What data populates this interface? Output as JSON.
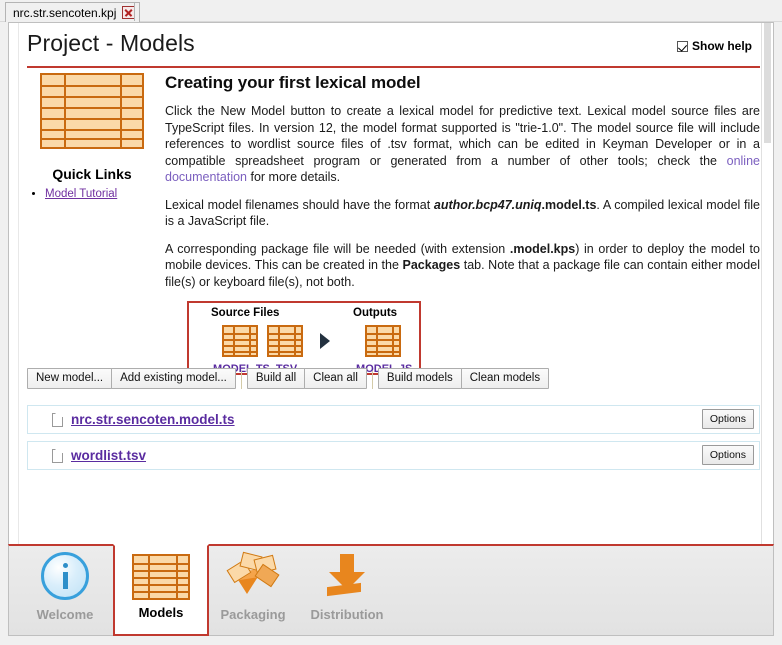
{
  "window": {
    "document_tab": {
      "label": "nrc.str.sencoten.kpj",
      "close_icon": "close-icon"
    }
  },
  "header": {
    "title": "Project - Models",
    "show_help_label": "Show help",
    "show_help_checked": true,
    "accent_color": "#c0392f"
  },
  "quick_links": {
    "icon": "model-grid-icon",
    "title": "Quick Links",
    "links": [
      {
        "label": "Model Tutorial"
      }
    ]
  },
  "help": {
    "section_title": "Creating your first lexical model",
    "paragraph1": {
      "before_link": "Click the New Model button to create a lexical model for predictive text. Lexical model source files are TypeScript files. In version 12, the model format supported is \"trie-1.0\". The model source file will include references to wordlist source files of .tsv format, which can be edited in Keyman Developer or in a compatible spreadsheet program or generated from a number of other tools; check the ",
      "link_text": "online documentation",
      "after_link": " for more details."
    },
    "paragraph2": {
      "part1": "Lexical model filenames should have the format ",
      "emphasis": "author.bcp47.uniq",
      "bold": ".model.ts",
      "part2": ". A compiled lexical model file is a JavaScript file."
    },
    "paragraph3": {
      "part1": "A corresponding package file will be needed (with extension ",
      "bold1": ".model.kps",
      "part2": ") in order to deploy the model to mobile devices. This can be created in the ",
      "bold2": "Packages",
      "part3": " tab. Note that a package file can contain either model file(s) or keyboard file(s), not both."
    }
  },
  "diagram": {
    "source_label": "Source Files",
    "outputs_label": "Outputs",
    "arrow_icon": "arrow-right-icon",
    "sources": [
      {
        "ext": ".MODEL.TS",
        "icon": "model-grid-icon"
      },
      {
        "ext": ".TSV",
        "icon": "model-grid-icon"
      }
    ],
    "outputs": [
      {
        "ext": ".MODEL.JS",
        "icon": "model-grid-icon"
      }
    ]
  },
  "toolbar": {
    "buttons_group1": [
      {
        "label": "New model..."
      },
      {
        "label": "Add existing model..."
      }
    ],
    "buttons_group2": [
      {
        "label": "Build all"
      },
      {
        "label": "Clean all"
      }
    ],
    "buttons_group3": [
      {
        "label": "Build models"
      },
      {
        "label": "Clean models"
      }
    ]
  },
  "file_list": {
    "options_label": "Options",
    "rows": [
      {
        "name": "nrc.str.sencoten.model.ts",
        "icon": "file-icon"
      },
      {
        "name": "wordlist.tsv",
        "icon": "file-icon"
      }
    ]
  },
  "bottom_tabs": {
    "active": "Models",
    "items": [
      {
        "label": "Welcome",
        "icon": "info-icon"
      },
      {
        "label": "Models",
        "icon": "model-grid-icon"
      },
      {
        "label": "Packaging",
        "icon": "package-box-icon"
      },
      {
        "label": "Distribution",
        "icon": "download-arrow-icon"
      }
    ]
  }
}
